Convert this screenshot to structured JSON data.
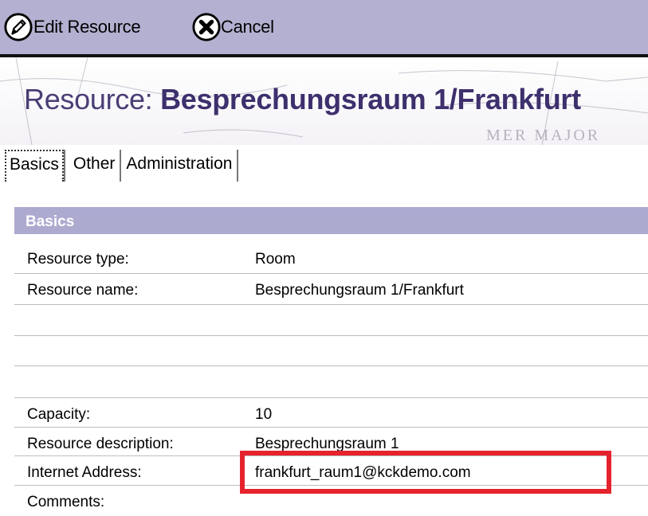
{
  "toolbar": {
    "edit_label": "Edit Resource",
    "cancel_label": "Cancel"
  },
  "banner": {
    "title_prefix": "Resource: ",
    "title_name": "Besprechungsraum 1/Frankfurt",
    "map_text": "MER MAJOR"
  },
  "tabs": [
    "Basics",
    "Other",
    "Administration"
  ],
  "section": {
    "title": "Basics"
  },
  "fields": [
    {
      "label": "Resource type:",
      "value": "Room"
    },
    {
      "label": "Resource name:",
      "value": "Besprechungsraum 1/Frankfurt"
    },
    {
      "label": "",
      "value": ""
    },
    {
      "label": "",
      "value": ""
    },
    {
      "label": "Capacity:",
      "value": "10"
    },
    {
      "label": "Resource description:",
      "value": "Besprechungsraum 1"
    },
    {
      "label": "Internet Address:",
      "value": "frankfurt_raum1@kckdemo.com"
    },
    {
      "label": "Comments:",
      "value": ""
    }
  ],
  "colors": {
    "toolbar_bg": "#b3b0d1",
    "section_header_bg": "#adaad0",
    "title_color": "#4b3d75",
    "highlight": "#e5232d"
  },
  "icons": {
    "edit": "pencil-circle-icon",
    "cancel": "x-circle-icon"
  }
}
